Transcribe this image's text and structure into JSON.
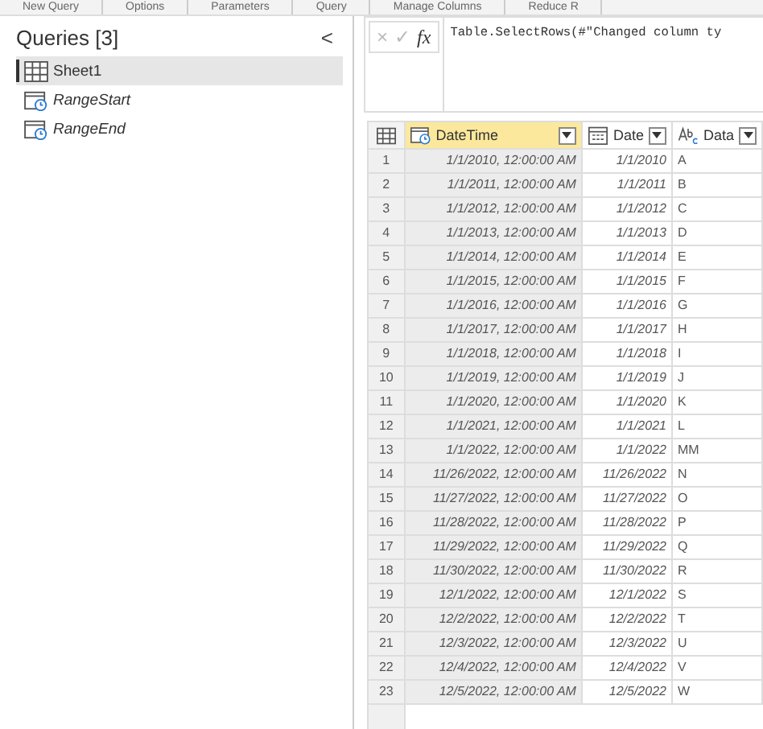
{
  "ribbon_groups": [
    "New Query",
    "Options",
    "Parameters",
    "Query",
    "Manage Columns",
    "Reduce R"
  ],
  "queries": {
    "title": "Queries [3]",
    "collapse": "<",
    "items": [
      {
        "label": "Sheet1",
        "kind": "table",
        "selected": true
      },
      {
        "label": "RangeStart",
        "kind": "parameter",
        "selected": false
      },
      {
        "label": "RangeEnd",
        "kind": "parameter",
        "selected": false
      }
    ]
  },
  "formula_bar": {
    "cancel": "×",
    "confirm": "✓",
    "fx": "fx",
    "formula": "Table.SelectRows(#\"Changed column ty"
  },
  "table": {
    "columns": [
      {
        "kind": "index",
        "selected": false
      },
      {
        "name": "DateTime",
        "kind": "datetime",
        "selected": true
      },
      {
        "name": "Date",
        "kind": "date",
        "selected": false
      },
      {
        "name": "Data",
        "kind": "text",
        "selected": false
      }
    ],
    "rows": [
      [
        "1",
        "1/1/2010, 12:00:00 AM",
        "1/1/2010",
        "A"
      ],
      [
        "2",
        "1/1/2011, 12:00:00 AM",
        "1/1/2011",
        "B"
      ],
      [
        "3",
        "1/1/2012, 12:00:00 AM",
        "1/1/2012",
        "C"
      ],
      [
        "4",
        "1/1/2013, 12:00:00 AM",
        "1/1/2013",
        "D"
      ],
      [
        "5",
        "1/1/2014, 12:00:00 AM",
        "1/1/2014",
        "E"
      ],
      [
        "6",
        "1/1/2015, 12:00:00 AM",
        "1/1/2015",
        "F"
      ],
      [
        "7",
        "1/1/2016, 12:00:00 AM",
        "1/1/2016",
        "G"
      ],
      [
        "8",
        "1/1/2017, 12:00:00 AM",
        "1/1/2017",
        "H"
      ],
      [
        "9",
        "1/1/2018, 12:00:00 AM",
        "1/1/2018",
        "I"
      ],
      [
        "10",
        "1/1/2019, 12:00:00 AM",
        "1/1/2019",
        "J"
      ],
      [
        "11",
        "1/1/2020, 12:00:00 AM",
        "1/1/2020",
        "K"
      ],
      [
        "12",
        "1/1/2021, 12:00:00 AM",
        "1/1/2021",
        "L"
      ],
      [
        "13",
        "1/1/2022, 12:00:00 AM",
        "1/1/2022",
        "MM"
      ],
      [
        "14",
        "11/26/2022, 12:00:00 AM",
        "11/26/2022",
        "N"
      ],
      [
        "15",
        "11/27/2022, 12:00:00 AM",
        "11/27/2022",
        "O"
      ],
      [
        "16",
        "11/28/2022, 12:00:00 AM",
        "11/28/2022",
        "P"
      ],
      [
        "17",
        "11/29/2022, 12:00:00 AM",
        "11/29/2022",
        "Q"
      ],
      [
        "18",
        "11/30/2022, 12:00:00 AM",
        "11/30/2022",
        "R"
      ],
      [
        "19",
        "12/1/2022, 12:00:00 AM",
        "12/1/2022",
        "S"
      ],
      [
        "20",
        "12/2/2022, 12:00:00 AM",
        "12/2/2022",
        "T"
      ],
      [
        "21",
        "12/3/2022, 12:00:00 AM",
        "12/3/2022",
        "U"
      ],
      [
        "22",
        "12/4/2022, 12:00:00 AM",
        "12/4/2022",
        "V"
      ],
      [
        "23",
        "12/5/2022, 12:00:00 AM",
        "12/5/2022",
        "W"
      ]
    ]
  }
}
